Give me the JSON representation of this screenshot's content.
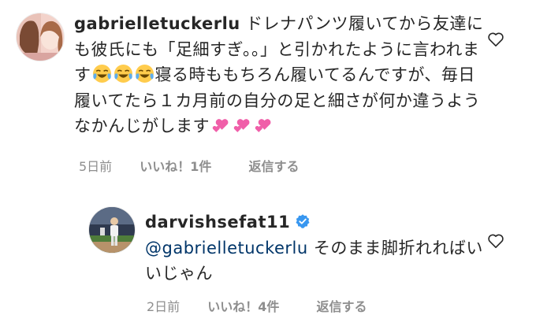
{
  "comments": [
    {
      "username": "gabrielletuckerlu",
      "text_part1": "ドレナパンツ履いてから友達にも彼氏にも「足細すぎ。。」と引かれたように言われます",
      "emoji1": "face-with-tears-of-joy-emoji",
      "text_part2": "寝る時ももちろん履いてるんですが、毎日履いてたら１カ月前の自分の足と細さが何か違うようなかんじがします",
      "emoji2": "two-hearts-emoji",
      "time": "5日前",
      "likes": "いいね！1件",
      "reply": "返信する",
      "like_icon": "heart-outline-icon"
    },
    {
      "username": "darvishsefat11",
      "verified_icon": "verified-badge-icon",
      "mention": "@gabrielletuckerlu",
      "text": "そのまま脚折れればいいじゃん",
      "time": "2日前",
      "likes": "いいね！4件",
      "reply": "返信する",
      "like_icon": "heart-outline-icon"
    }
  ],
  "colors": {
    "text": "#262626",
    "meta": "#8e8e8e",
    "mention": "#003569",
    "verified": "#3897f0"
  }
}
